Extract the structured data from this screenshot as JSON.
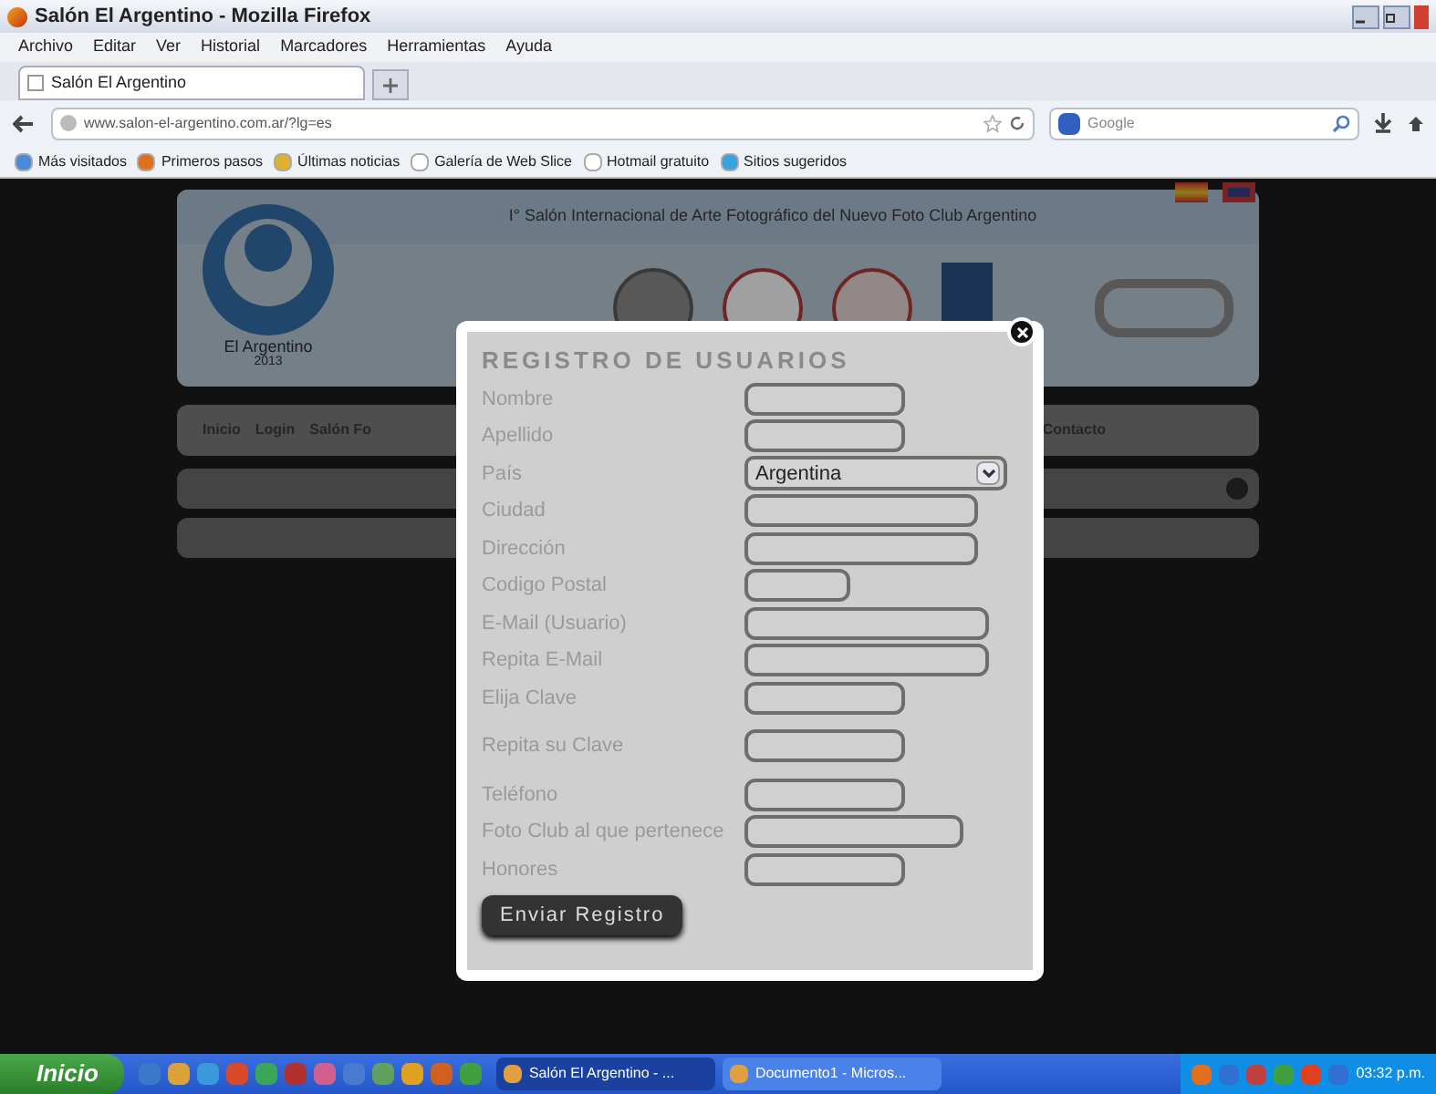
{
  "window": {
    "title": "Salón El Argentino - Mozilla Firefox"
  },
  "menu_bar": [
    "Archivo",
    "Editar",
    "Ver",
    "Historial",
    "Marcadores",
    "Herramientas",
    "Ayuda"
  ],
  "tabs": [
    {
      "label": "Salón El Argentino",
      "selected": true
    }
  ],
  "address_bar": {
    "url": "www.salon-el-argentino.com.ar/?lg=es"
  },
  "search_field": {
    "placeholder": "Google"
  },
  "bookmarks": [
    "Más visitados",
    "Primeros pasos",
    "Últimas noticias",
    "Galería de Web Slice",
    "Hotmail gratuito",
    "Sitios sugeridos"
  ],
  "site": {
    "title": "I° Salón Internacional de Arte Fotográfico del Nuevo Foto Club Argentino",
    "logo_caption": "El Argentino",
    "logo_year": "2013",
    "nav": [
      "Inicio",
      "Login",
      "Salón Fo",
      "Contacto"
    ]
  },
  "dialog": {
    "title": "REGISTRO DE USUARIOS",
    "fields": [
      {
        "label": "Nombre",
        "kind": "text"
      },
      {
        "label": "Apellido",
        "kind": "text"
      },
      {
        "label": "País",
        "kind": "select",
        "value": "Argentina"
      },
      {
        "label": "Ciudad",
        "kind": "text"
      },
      {
        "label": "Dirección",
        "kind": "text"
      },
      {
        "label": "Codigo Postal",
        "kind": "text"
      },
      {
        "label": "E-Mail (Usuario)",
        "kind": "text"
      },
      {
        "label": "Repita E-Mail",
        "kind": "text"
      },
      {
        "label": "Elija Clave",
        "kind": "text"
      },
      {
        "label": "Repita su Clave",
        "kind": "text"
      },
      {
        "label": "Teléfono",
        "kind": "text"
      },
      {
        "label": "Foto Club al que pertenece",
        "kind": "text"
      },
      {
        "label": "Honores",
        "kind": "text"
      }
    ],
    "submit": "Enviar Registro"
  },
  "taskbar": {
    "start": "Inicio",
    "tasks": [
      {
        "label": "Salón El Argentino - ...",
        "selected": true
      },
      {
        "label": "Documento1 - Micros...",
        "selected": false
      }
    ],
    "clock": "03:32 p.m."
  }
}
